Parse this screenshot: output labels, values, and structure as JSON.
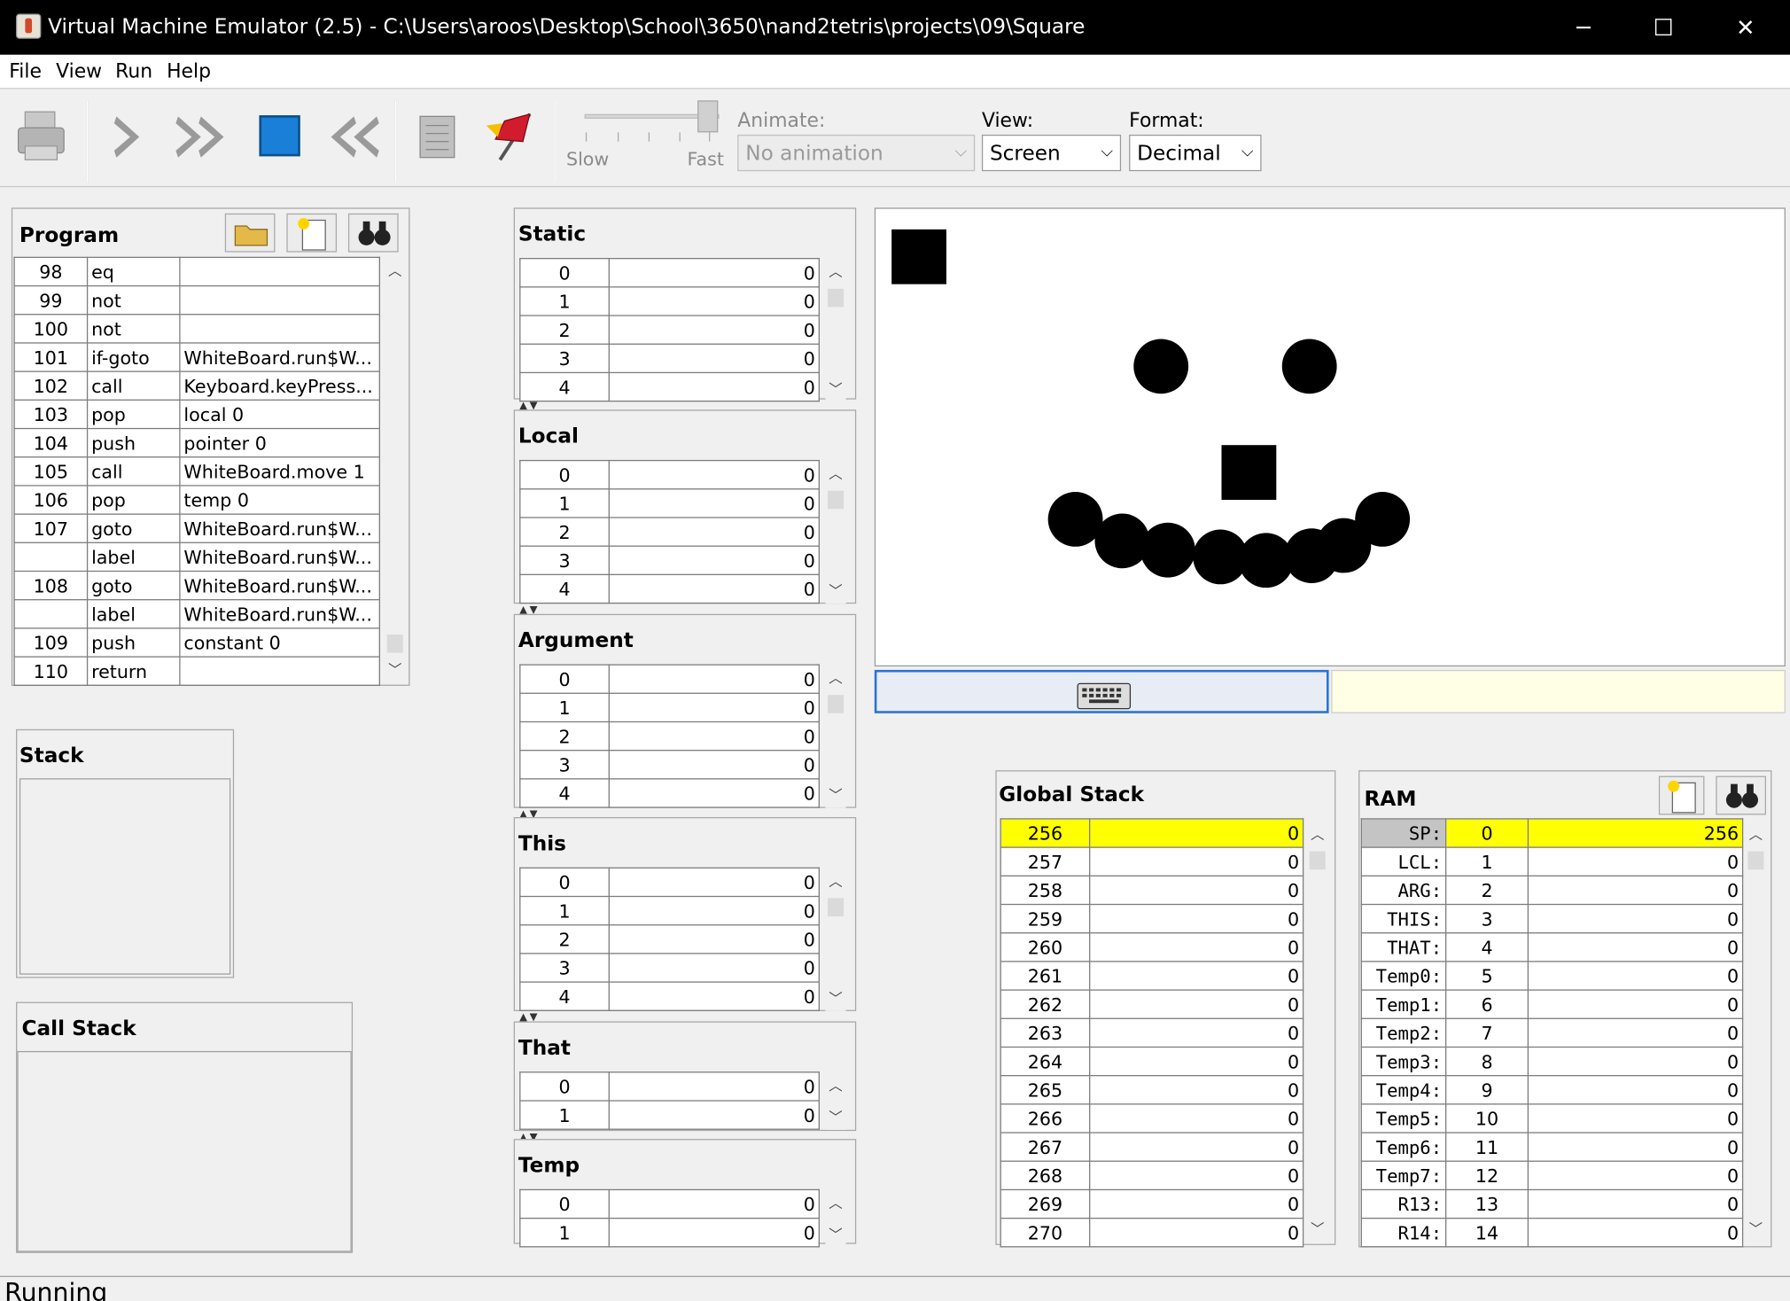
{
  "window": {
    "title": "Virtual Machine Emulator (2.5) - C:\\Users\\aroos\\Desktop\\School\\3650\\nand2tetris\\projects\\09\\Square",
    "minimize": "─",
    "maximize": "☐",
    "close": "✕"
  },
  "menu": [
    "File",
    "View",
    "Run",
    "Help"
  ],
  "toolbar": {
    "speed_slow": "Slow",
    "speed_fast": "Fast",
    "animate_label": "Animate:",
    "animate_value": "No animation",
    "view_label": "View:",
    "view_value": "Screen",
    "format_label": "Format:",
    "format_value": "Decimal",
    "icons": [
      "print-icon",
      "step-icon",
      "fast-forward-icon",
      "stop-icon",
      "rewind-icon",
      "script-icon",
      "breakpoint-flag-icon"
    ]
  },
  "program": {
    "title": "Program",
    "rows": [
      [
        "98",
        "eq",
        ""
      ],
      [
        "99",
        "not",
        ""
      ],
      [
        "100",
        "not",
        ""
      ],
      [
        "101",
        "if-goto",
        "WhiteBoard.run$W..."
      ],
      [
        "102",
        "call",
        "Keyboard.keyPress..."
      ],
      [
        "103",
        "pop",
        "local 0"
      ],
      [
        "104",
        "push",
        "pointer 0"
      ],
      [
        "105",
        "call",
        "WhiteBoard.move 1"
      ],
      [
        "106",
        "pop",
        "temp 0"
      ],
      [
        "107",
        "goto",
        "WhiteBoard.run$W..."
      ],
      [
        "",
        "label",
        "WhiteBoard.run$W..."
      ],
      [
        "108",
        "goto",
        "WhiteBoard.run$W..."
      ],
      [
        "",
        "label",
        "WhiteBoard.run$W..."
      ],
      [
        "109",
        "push",
        "constant 0"
      ],
      [
        "110",
        "return",
        ""
      ]
    ]
  },
  "stack": {
    "title": "Stack"
  },
  "call_stack": {
    "title": "Call Stack"
  },
  "segments": [
    {
      "title": "Static",
      "rows": [
        [
          "0",
          "0"
        ],
        [
          "1",
          "0"
        ],
        [
          "2",
          "0"
        ],
        [
          "3",
          "0"
        ],
        [
          "4",
          "0"
        ]
      ]
    },
    {
      "title": "Local",
      "rows": [
        [
          "0",
          "0"
        ],
        [
          "1",
          "0"
        ],
        [
          "2",
          "0"
        ],
        [
          "3",
          "0"
        ],
        [
          "4",
          "0"
        ]
      ]
    },
    {
      "title": "Argument",
      "rows": [
        [
          "0",
          "0"
        ],
        [
          "1",
          "0"
        ],
        [
          "2",
          "0"
        ],
        [
          "3",
          "0"
        ],
        [
          "4",
          "0"
        ]
      ]
    },
    {
      "title": "This",
      "rows": [
        [
          "0",
          "0"
        ],
        [
          "1",
          "0"
        ],
        [
          "2",
          "0"
        ],
        [
          "3",
          "0"
        ],
        [
          "4",
          "0"
        ]
      ]
    },
    {
      "title": "That",
      "rows": [
        [
          "0",
          "0"
        ],
        [
          "1",
          "0"
        ]
      ]
    },
    {
      "title": "Temp",
      "rows": [
        [
          "0",
          "0"
        ],
        [
          "1",
          "0"
        ]
      ]
    }
  ],
  "global_stack": {
    "title": "Global Stack",
    "rows": [
      [
        "256",
        "0"
      ],
      [
        "257",
        "0"
      ],
      [
        "258",
        "0"
      ],
      [
        "259",
        "0"
      ],
      [
        "260",
        "0"
      ],
      [
        "261",
        "0"
      ],
      [
        "262",
        "0"
      ],
      [
        "263",
        "0"
      ],
      [
        "264",
        "0"
      ],
      [
        "265",
        "0"
      ],
      [
        "266",
        "0"
      ],
      [
        "267",
        "0"
      ],
      [
        "268",
        "0"
      ],
      [
        "269",
        "0"
      ],
      [
        "270",
        "0"
      ]
    ]
  },
  "ram": {
    "title": "RAM",
    "rows": [
      [
        "SP:",
        "0",
        "256"
      ],
      [
        "LCL:",
        "1",
        "0"
      ],
      [
        "ARG:",
        "2",
        "0"
      ],
      [
        "THIS:",
        "3",
        "0"
      ],
      [
        "THAT:",
        "4",
        "0"
      ],
      [
        "Temp0:",
        "5",
        "0"
      ],
      [
        "Temp1:",
        "6",
        "0"
      ],
      [
        "Temp2:",
        "7",
        "0"
      ],
      [
        "Temp3:",
        "8",
        "0"
      ],
      [
        "Temp4:",
        "9",
        "0"
      ],
      [
        "Temp5:",
        "10",
        "0"
      ],
      [
        "Temp6:",
        "11",
        "0"
      ],
      [
        "Temp7:",
        "12",
        "0"
      ],
      [
        "R13:",
        "13",
        "0"
      ],
      [
        "R14:",
        "14",
        "0"
      ]
    ]
  },
  "status": {
    "text": "Running"
  },
  "colors": {
    "highlight": "#ffff00",
    "keyboard_border": "#2a72d6",
    "screen_ink": "#000000"
  }
}
